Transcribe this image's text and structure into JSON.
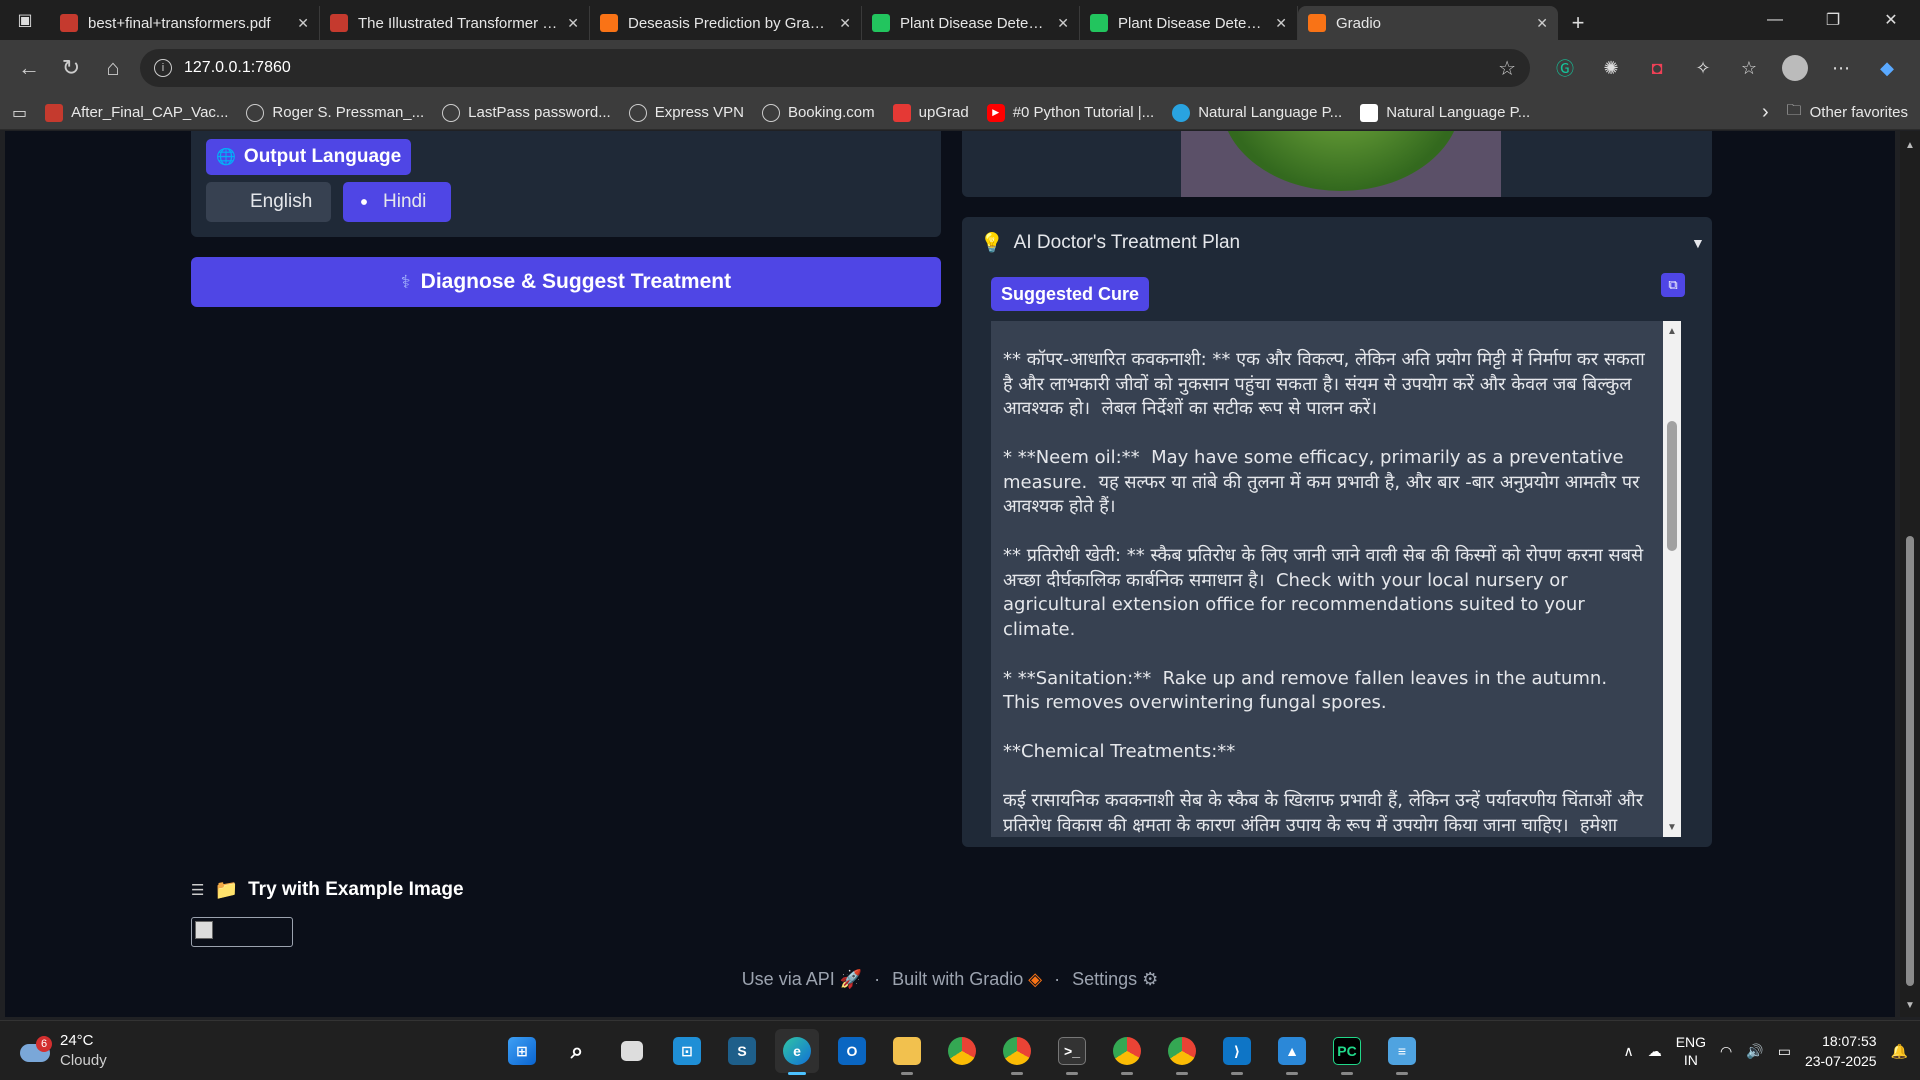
{
  "browser": {
    "tabs": [
      {
        "label": "best+final+transformers.pdf",
        "icon": "pdf-icon",
        "color": "#c53a2e"
      },
      {
        "label": "The Illustrated Transformer – Jay",
        "icon": "pdf-icon",
        "color": "#c53a2e"
      },
      {
        "label": "Deseasis Prediction by Gradio",
        "icon": "gradio-icon",
        "color": "#f97316"
      },
      {
        "label": "Plant Disease Detector w",
        "icon": "plant-icon",
        "color": "#22c55e"
      },
      {
        "label": "Plant Disease Detector w",
        "icon": "plant-icon",
        "color": "#22c55e"
      },
      {
        "label": "Gradio",
        "icon": "gradio-icon",
        "color": "#f97316"
      }
    ],
    "url": "127.0.0.1:7860",
    "bookmarks": [
      {
        "label": "After_Final_CAP_Vac...",
        "kind": "pdf"
      },
      {
        "label": "Roger S. Pressman_...",
        "kind": "globe"
      },
      {
        "label": "LastPass password...",
        "kind": "globe"
      },
      {
        "label": "Express VPN",
        "kind": "globe"
      },
      {
        "label": "Booking.com",
        "kind": "globe"
      },
      {
        "label": "upGrad",
        "kind": "red"
      },
      {
        "label": "#0 Python Tutorial |...",
        "kind": "yt"
      },
      {
        "label": "Natural Language P...",
        "kind": "blue"
      },
      {
        "label": "Natural Language P...",
        "kind": "black"
      }
    ],
    "other_favorites": "Other favorites"
  },
  "app": {
    "output_language_label": "Output Language",
    "language_options": [
      "English",
      "Hindi"
    ],
    "selected_language": "Hindi",
    "diagnose_button": "Diagnose & Suggest Treatment",
    "treatment_title": "AI Doctor's Treatment Plan",
    "suggested_cure_label": "Suggested Cure",
    "cure_text": "disease is established.  नोट: सल्फर गर्म मौसम में पत्ते जला सकता है।\n\n** कॉपर-आधारित कवकनाशी: ** एक और विकल्प, लेकिन अति प्रयोग मिट्टी में निर्माण कर सकता है और लाभकारी जीवों को नुकसान पहुंचा सकता है। संयम से उपयोग करें और केवल जब बिल्कुल आवश्यक हो।  लेबल निर्देशों का सटीक रूप से पालन करें।\n\n* **Neem oil:**  May have some efficacy, primarily as a preventative measure.  यह सल्फर या तांबे की तुलना में कम प्रभावी है, और बार -बार अनुप्रयोग आमतौर पर आवश्यक होते हैं।\n\n** प्रतिरोधी खेती: ** स्कैब प्रतिरोध के लिए जानी जाने वाली सेब की किस्मों को रोपण करना सबसे अच्छा दीर्घकालिक कार्बनिक समाधान है।  Check with your local nursery or agricultural extension office for recommendations suited to your climate.\n\n* **Sanitation:**  Rake up and remove fallen leaves in the autumn.  This removes overwintering fungal spores.\n\n**Chemical Treatments:**\n\nकई रासायनिक कवकनाशी सेब के स्कैब के खिलाफ प्रभावी हैं, लेकिन उन्हें पर्यावरणीय चिंताओं और प्रतिरोध विकास की क्षमता के कारण अंतिम उपाय के रूप में उपयोग किया जाना चाहिए।  हमेशा अपने स्थानीय कृषि विस्तार कार्यालय या विशेषज्ञों और सटीक आवेदन विधियों के लिए",
    "examples_label": "Try with Example Image",
    "footer": {
      "api": "Use via API",
      "built": "Built with Gradio",
      "settings": "Settings",
      "sep": "·"
    }
  },
  "taskbar": {
    "weather_temp": "24°C",
    "weather_desc": "Cloudy",
    "weather_badge": "6",
    "lang_top": "ENG",
    "lang_bottom": "IN",
    "time": "18:07:53",
    "date": "23-07-2025"
  },
  "colors": {
    "accent": "#4f46e5",
    "page_bg": "#0b0f19",
    "panel_bg": "#1f2937",
    "textbox_bg": "#374151"
  }
}
